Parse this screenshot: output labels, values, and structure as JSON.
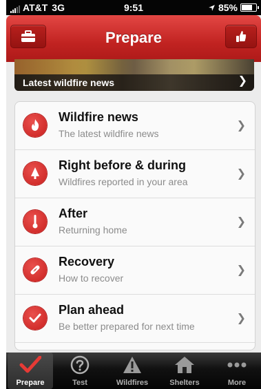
{
  "status_bar": {
    "carrier": "AT&T",
    "network": "3G",
    "time": "9:51",
    "battery": "85%",
    "battery_level": 0.85
  },
  "nav": {
    "title": "Prepare",
    "left_icon": "first-aid-kit-icon",
    "right_icon": "thumbs-up-icon"
  },
  "banner": {
    "label": "Latest wildfire news"
  },
  "menu": {
    "items": [
      {
        "title": "Wildfire news",
        "subtitle": "The latest wildfire news",
        "icon": "flame-icon"
      },
      {
        "title": "Right before & during",
        "subtitle": "Wildfires reported in your area",
        "icon": "tree-fire-icon"
      },
      {
        "title": "After",
        "subtitle": "Returning home",
        "icon": "thermometer-icon"
      },
      {
        "title": "Recovery",
        "subtitle": "How to recover",
        "icon": "bandage-icon"
      },
      {
        "title": "Plan ahead",
        "subtitle": "Be better prepared for next time",
        "icon": "checkmark-icon"
      }
    ]
  },
  "tabbar": {
    "tabs": [
      {
        "label": "Prepare",
        "icon": "checkmark-icon",
        "active": true
      },
      {
        "label": "Test",
        "icon": "question-icon",
        "active": false
      },
      {
        "label": "Wildfires",
        "icon": "warning-icon",
        "active": false
      },
      {
        "label": "Shelters",
        "icon": "house-icon",
        "active": false
      },
      {
        "label": "More",
        "icon": "ellipsis-icon",
        "active": false
      }
    ]
  },
  "colors": {
    "brand_red": "#c12321",
    "tab_active": "#ffffff",
    "tab_inactive": "#b0b0b0"
  }
}
